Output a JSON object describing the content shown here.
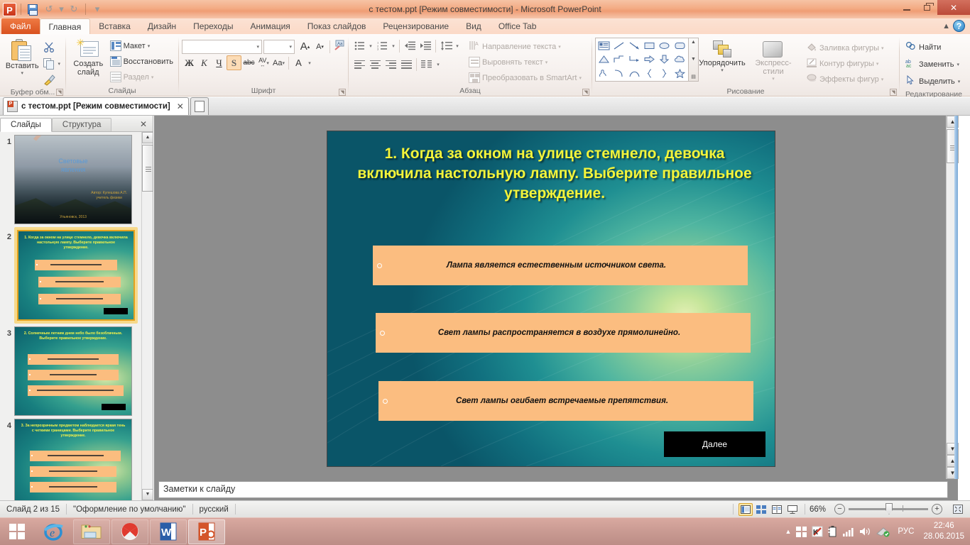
{
  "window": {
    "title": "с тестом.ppt [Режим совместимости]  -  Microsoft PowerPoint",
    "app_logo": "P",
    "minimize": "minimize-icon",
    "restore": "restore-icon",
    "close": "✕",
    "help": "?",
    "collapse_ribbon": "▲"
  },
  "quick_access": {
    "save": "save-icon",
    "undo": "↺",
    "redo": "↻",
    "customize": "▾"
  },
  "ribbon_tabs": [
    {
      "label": "Файл",
      "type": "file"
    },
    {
      "label": "Главная",
      "type": "active"
    },
    {
      "label": "Вставка",
      "type": "normal"
    },
    {
      "label": "Дизайн",
      "type": "normal"
    },
    {
      "label": "Переходы",
      "type": "normal"
    },
    {
      "label": "Анимация",
      "type": "normal"
    },
    {
      "label": "Показ слайдов",
      "type": "normal"
    },
    {
      "label": "Рецензирование",
      "type": "normal"
    },
    {
      "label": "Вид",
      "type": "normal"
    },
    {
      "label": "Office Tab",
      "type": "normal"
    }
  ],
  "ribbon": {
    "clipboard": {
      "title": "Буфер обм...",
      "paste": "Вставить",
      "cut": "cut-icon",
      "copy": "copy-icon",
      "format_painter": "format-painter-icon"
    },
    "slides": {
      "title": "Слайды",
      "new_slide": "Создать\nслайд",
      "new_slide_line1": "Создать",
      "new_slide_line2": "слайд",
      "layout": "Макет",
      "reset": "Восстановить",
      "section": "Раздел"
    },
    "font": {
      "title": "Шрифт",
      "font_name": "",
      "font_size": "",
      "grow_font": "A",
      "shrink_font": "A",
      "clear_formatting": "clear-formatting-icon",
      "bold": "Ж",
      "italic": "К",
      "underline": "Ч",
      "shadow": "S",
      "strikethrough": "abc",
      "character_spacing": "AV",
      "change_case": "Aa",
      "font_color": "A"
    },
    "paragraph": {
      "title": "Абзац",
      "bullets": "bullets-icon",
      "numbering": "numbering-icon",
      "decrease_indent": "decrease-indent-icon",
      "increase_indent": "increase-indent-icon",
      "line_spacing": "line-spacing-icon",
      "align_left": "align-left-icon",
      "align_center": "align-center-icon",
      "align_right": "align-right-icon",
      "justify": "justify-icon",
      "columns": "columns-icon",
      "text_direction": "Направление текста",
      "align_text": "Выровнять текст",
      "convert_smartart": "Преобразовать в SmartArt"
    },
    "drawing": {
      "title": "Рисование",
      "arrange": "Упорядочить",
      "quick_styles": "Экспресс-стили",
      "shape_fill": "Заливка фигуры",
      "shape_outline": "Контур фигуры",
      "shape_effects": "Эффекты фигур",
      "shapes": [
        "textbox-shape",
        "line-shape",
        "arrow-shape",
        "rectangle-shape",
        "oval-shape",
        "rounded-rectangle-shape",
        "triangle-shape",
        "elbow-connector-shape",
        "elbow-arrow-shape",
        "right-arrow-shape",
        "down-arrow-shape",
        "cloud-shape",
        "scribble-shape",
        "curve-shape",
        "arc-shape",
        "left-brace-shape",
        "right-brace-shape",
        "star-shape"
      ]
    },
    "editing": {
      "title": "Редактирование",
      "find": "Найти",
      "replace": "Заменить",
      "select": "Выделить"
    }
  },
  "office_tab": {
    "document_tab": "с тестом.ppt [Режим совместимости]",
    "close_tab": "✕",
    "new_tab": "new-document-icon"
  },
  "left_pane": {
    "tab_slides": "Слайды",
    "tab_outline": "Структура",
    "close": "✕",
    "thumbnails": [
      {
        "number": "1",
        "type": "title",
        "title": "Световые\nявления",
        "title_line1": "Световые",
        "title_line2": "явления",
        "author_line1": "Автор: Кулешова А.П.",
        "author_line2": "учитель физики",
        "year": "Ульяновск, 2013",
        "selected": false
      },
      {
        "number": "2",
        "type": "question",
        "title": "1. Когда за окном на улице стемнело, девочка включила настольную лампу. Выберите правильное утверждение.",
        "selected": true
      },
      {
        "number": "3",
        "type": "question",
        "title": "2. Солнечным  летним днем небо было безоблачным. Выберите  правильное  утверждение.",
        "selected": false
      },
      {
        "number": "4",
        "type": "question",
        "title": "3. За непрозрачным  предметом наблюдается яркая тень с четкими границами. Выберите правильное утверждение.",
        "selected": false
      }
    ]
  },
  "slide": {
    "title": "1. Когда за окном на улице стемнело, девочка включила настольную лампу. Выберите правильное утверждение.",
    "options": [
      {
        "text": "Лампа является естественным источником света."
      },
      {
        "text": "Свет лампы распространяется в воздухе прямолинейно."
      },
      {
        "text": "Свет лампы огибает встречаемые препятствия."
      }
    ],
    "next_button": "Далее",
    "colors": {
      "title_text": "#f4f43a",
      "option_fill": "#fbbd80",
      "button_fill": "#000000",
      "background_teal": "#11707f",
      "background_light": "#d9e8a8"
    }
  },
  "notes": {
    "placeholder": "Заметки к слайду"
  },
  "status_bar": {
    "slide_counter": "Слайд 2 из 15",
    "theme": "\"Оформление по умолчанию\"",
    "language": "русский",
    "view_normal": "normal-view-icon",
    "view_sorter": "slide-sorter-icon",
    "view_reading": "reading-view-icon",
    "view_slideshow": "slideshow-icon",
    "zoom_level": "66%",
    "zoom_out": "−",
    "zoom_in": "+",
    "fit_to_window": "fit-slide-icon"
  },
  "taskbar": {
    "start": "windows-start-icon",
    "items": [
      {
        "name": "internet-explorer-icon",
        "label": "e"
      },
      {
        "name": "file-explorer-icon",
        "label": ""
      },
      {
        "name": "yandex-browser-icon",
        "label": ""
      },
      {
        "name": "microsoft-word-icon",
        "label": "W"
      },
      {
        "name": "microsoft-powerpoint-icon",
        "label": "P",
        "active": true
      }
    ],
    "tray": {
      "show_hidden": "▲",
      "language": "РУС",
      "time": "22:46",
      "date": "28.06.2015"
    }
  }
}
